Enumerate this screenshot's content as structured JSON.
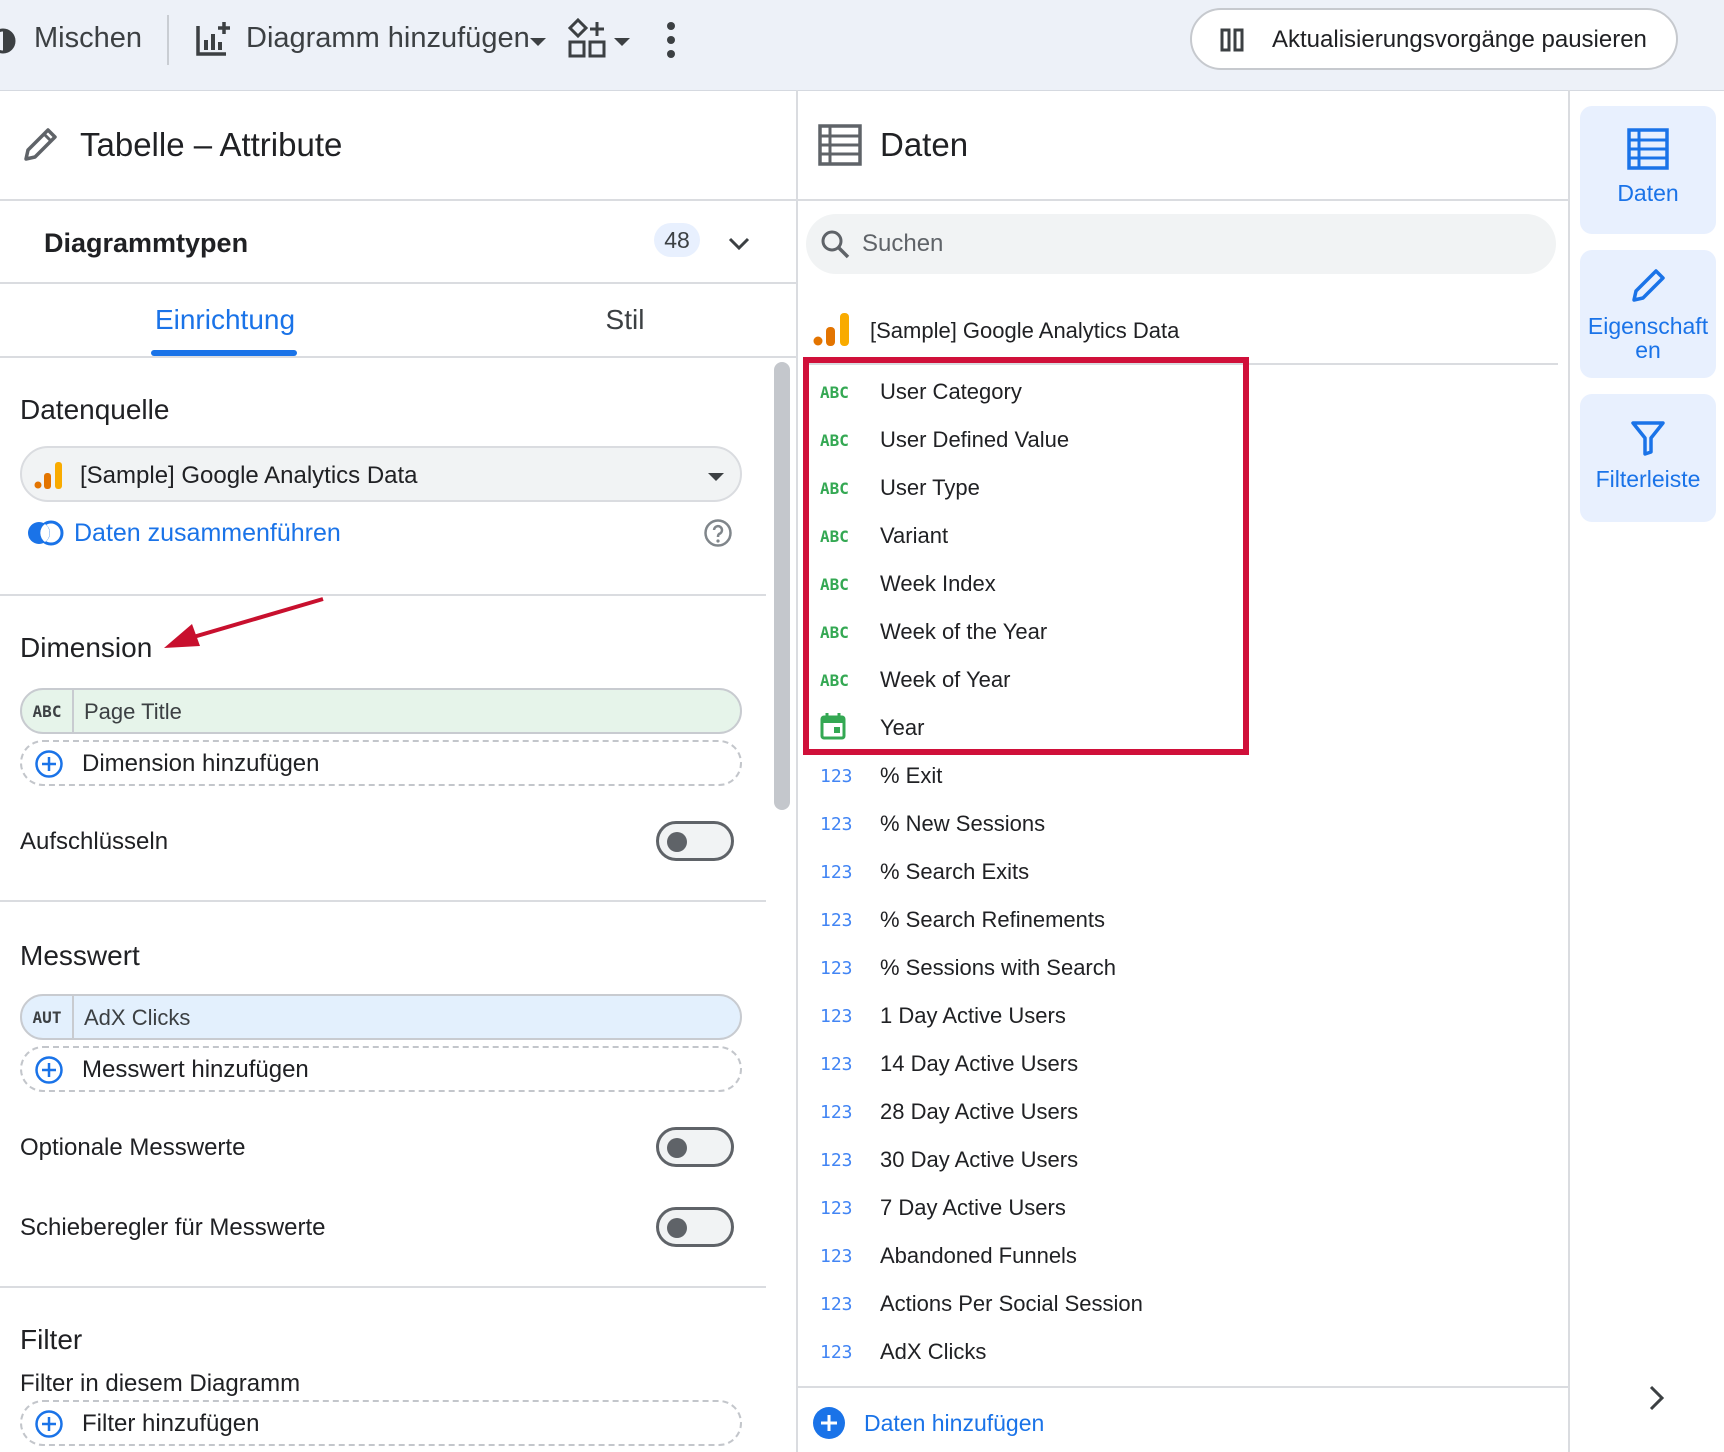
{
  "toolbar": {
    "mix_label": "Mischen",
    "add_chart_label": "Diagramm hinzufügen",
    "pause_label": "Aktualisierungsvorgänge pausieren"
  },
  "left_panel": {
    "title": "Tabelle – Attribute",
    "chart_types_label": "Diagrammtypen",
    "chart_types_count": "48",
    "tabs": [
      {
        "label": "Einrichtung",
        "active": true
      },
      {
        "label": "Stil",
        "active": false
      }
    ],
    "datasource": {
      "heading": "Datenquelle",
      "selected": "[Sample] Google Analytics Data",
      "blend_link": "Daten zusammenführen"
    },
    "dimension": {
      "heading": "Dimension",
      "chip_type": "ABC",
      "chip_label": "Page Title",
      "add_label": "Dimension hinzufügen",
      "drilldown_label": "Aufschlüsseln"
    },
    "metric": {
      "heading": "Messwert",
      "chip_type": "AUT",
      "chip_label": "AdX Clicks",
      "add_label": "Messwert hinzufügen",
      "optional_label": "Optionale Messwerte",
      "slider_label": "Schieberegler für Messwerte"
    },
    "filter": {
      "heading": "Filter",
      "subheading": "Filter in diesem Diagramm",
      "add_label": "Filter hinzufügen"
    }
  },
  "data_panel": {
    "title": "Daten",
    "search_placeholder": "Suchen",
    "source_name": "[Sample] Google Analytics Data",
    "fields": [
      {
        "type": "ABC",
        "name": "User Category"
      },
      {
        "type": "ABC",
        "name": "User Defined Value"
      },
      {
        "type": "ABC",
        "name": "User Type"
      },
      {
        "type": "ABC",
        "name": "Variant"
      },
      {
        "type": "ABC",
        "name": "Week Index"
      },
      {
        "type": "ABC",
        "name": "Week of the Year"
      },
      {
        "type": "ABC",
        "name": "Week of Year"
      },
      {
        "type": "calendar-icon",
        "name": "Year"
      },
      {
        "type": "123",
        "name": "% Exit"
      },
      {
        "type": "123",
        "name": "% New Sessions"
      },
      {
        "type": "123",
        "name": "% Search Exits"
      },
      {
        "type": "123",
        "name": "% Search Refinements"
      },
      {
        "type": "123",
        "name": "% Sessions with Search"
      },
      {
        "type": "123",
        "name": "1 Day Active Users"
      },
      {
        "type": "123",
        "name": "14 Day Active Users"
      },
      {
        "type": "123",
        "name": "28 Day Active Users"
      },
      {
        "type": "123",
        "name": "30 Day Active Users"
      },
      {
        "type": "123",
        "name": "7 Day Active Users"
      },
      {
        "type": "123",
        "name": "Abandoned Funnels"
      },
      {
        "type": "123",
        "name": "Actions Per Social Session"
      },
      {
        "type": "123",
        "name": "AdX Clicks"
      }
    ],
    "add_data_label": "Daten hinzufügen"
  },
  "rail": {
    "data_label": "Daten",
    "properties_label": "Eigenschaften",
    "filterbar_label": "Filterleiste"
  },
  "colors": {
    "accent": "#1a73e8",
    "dimension_green": "#34a853",
    "metric_blue": "#4285f4",
    "highlight_red": "#d0103a",
    "dimension_chip_bg": "#e6f4ea",
    "metric_chip_bg": "#e3f0fd"
  }
}
